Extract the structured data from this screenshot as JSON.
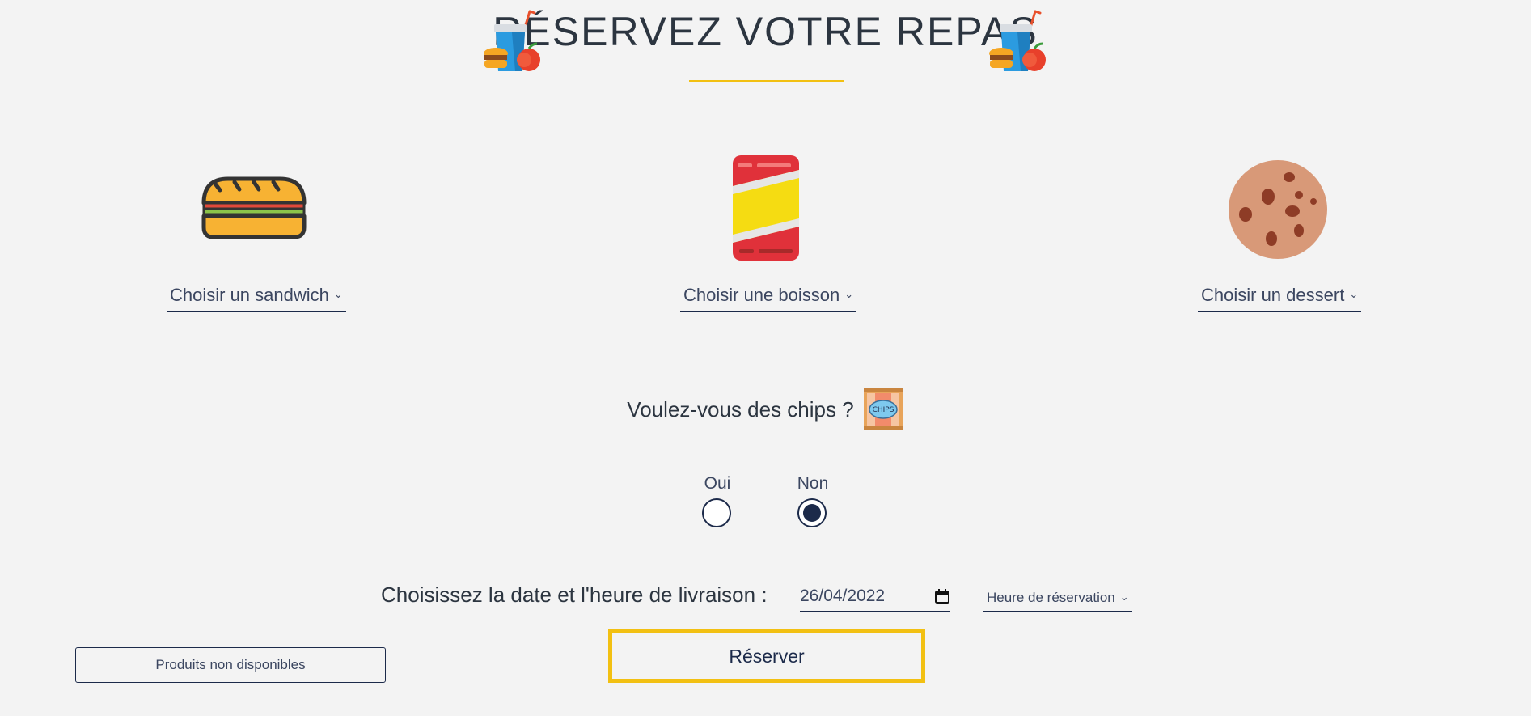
{
  "header": {
    "title": "RÉSERVEZ VOTRE REPAS",
    "icon": "meal-icon"
  },
  "products": {
    "sandwich": {
      "icon": "sandwich-icon",
      "select_label": "Choisir un sandwich"
    },
    "drink": {
      "icon": "soda-can-icon",
      "select_label": "Choisir une boisson"
    },
    "dessert": {
      "icon": "cookie-icon",
      "select_label": "Choisir un dessert"
    }
  },
  "chips": {
    "question": "Voulez-vous des chips ?",
    "icon": "chips-bag-icon",
    "options": [
      {
        "label": "Oui",
        "selected": false
      },
      {
        "label": "Non",
        "selected": true
      }
    ]
  },
  "delivery": {
    "label": "Choisissez la date et l'heure de livraison :",
    "date_value": "26/04/2022",
    "time_select_label": "Heure de réservation"
  },
  "actions": {
    "reserve_label": "Réserver",
    "unavailable_label": "Produits non disponibles"
  },
  "colors": {
    "accent": "#f2c012",
    "navy": "#1c2a4a",
    "background": "#f3f3f3"
  }
}
